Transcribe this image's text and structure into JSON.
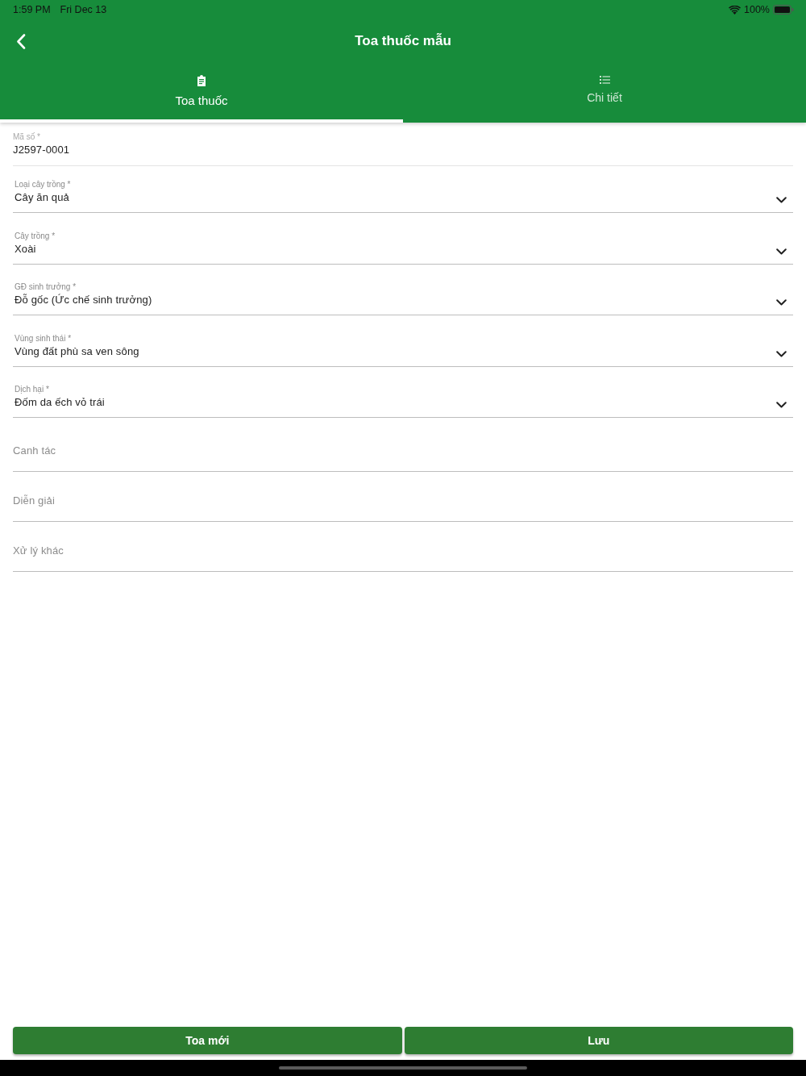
{
  "status_bar": {
    "time": "1:59 PM",
    "date": "Fri Dec 13",
    "battery": "100%"
  },
  "header": {
    "title": "Toa thuốc mẫu"
  },
  "tabs": [
    {
      "label": "Toa thuốc",
      "selected": true
    },
    {
      "label": "Chi tiết",
      "selected": false
    }
  ],
  "fields": [
    {
      "kind": "text",
      "label": "Mã số *",
      "value": "J2597-0001",
      "disabled": true
    },
    {
      "kind": "select",
      "label": "Loại cây trồng *",
      "value": "Cây ăn quả",
      "disabled": false
    },
    {
      "kind": "select",
      "label": "Cây trồng *",
      "value": "Xoài",
      "disabled": false
    },
    {
      "kind": "select",
      "label": "GĐ sinh trưởng *",
      "value": "Đỗ gốc (Ức chế sinh trưởng)",
      "disabled": false
    },
    {
      "kind": "select",
      "label": "Vùng sinh thái *",
      "value": "Vùng đất phù sa ven sông",
      "disabled": false
    },
    {
      "kind": "select",
      "label": "Dịch hại *",
      "value": "Đốm da ếch vỏ trái",
      "disabled": false
    },
    {
      "kind": "text",
      "placeholder": "Canh tác",
      "disabled": false
    },
    {
      "kind": "text",
      "placeholder": "Diễn giải",
      "disabled": false
    },
    {
      "kind": "text",
      "placeholder": "Xử lý khác",
      "disabled": false
    }
  ],
  "buttons": [
    "Toa mới",
    "Lưu"
  ]
}
